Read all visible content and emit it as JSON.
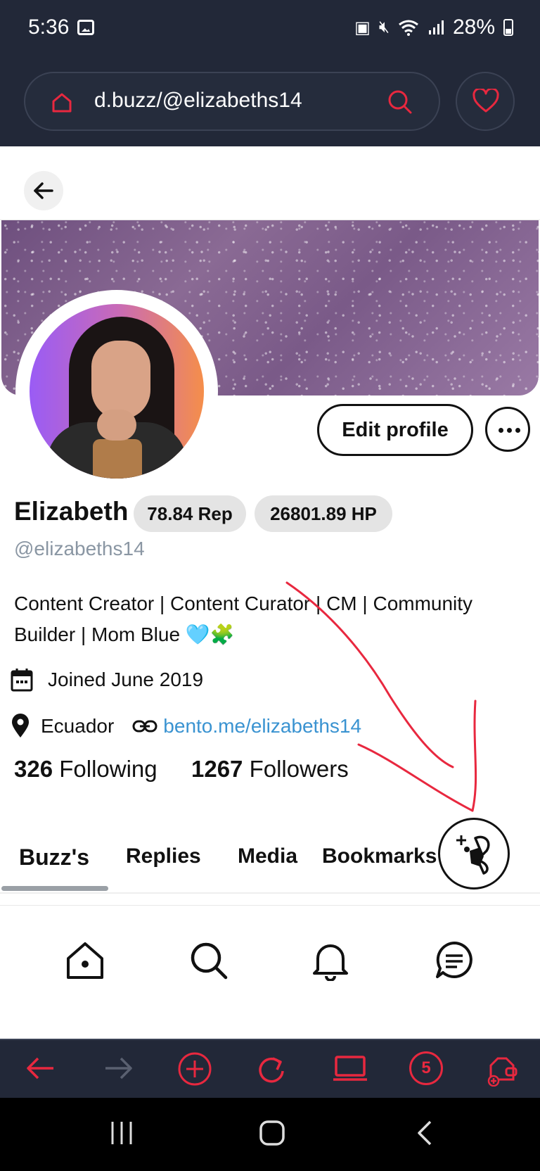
{
  "status_bar": {
    "time": "5:36",
    "battery_percent": "28%",
    "icons": [
      "gallery-icon",
      "battery-saver-icon",
      "mute-icon",
      "wifi-icon",
      "signal-icon",
      "battery-icon"
    ]
  },
  "browser": {
    "url": "d.buzz/@elizabeths14",
    "accent_color": "#e8283f",
    "bar_color": "#222838",
    "tab_count": "5"
  },
  "profile": {
    "name": "Elizabeth",
    "reputation": "78.84 Rep",
    "hive_power": "26801.89 HP",
    "handle": "@elizabeths14",
    "bio": "Content Creator | Content Curator | CM | Community Builder | Mom Blue 🩵🧩",
    "joined": "Joined June 2019",
    "location": "Ecuador",
    "website": "bento.me/elizabeths14",
    "following_count": "326",
    "following_label": "Following",
    "followers_count": "1267",
    "followers_label": "Followers",
    "edit_profile_label": "Edit profile"
  },
  "tabs": [
    {
      "label": "Buzz's",
      "active": true
    },
    {
      "label": "Replies",
      "active": false
    },
    {
      "label": "Media",
      "active": false
    },
    {
      "label": "Bookmarks",
      "active": false
    }
  ],
  "bottom_nav": [
    "home-icon",
    "search-icon",
    "notifications-icon",
    "messages-icon"
  ],
  "colors": {
    "link": "#3a93d1",
    "handle_gray": "#8a96a3",
    "badge_bg": "#e4e4e4",
    "annotation_red": "#e8283f"
  }
}
